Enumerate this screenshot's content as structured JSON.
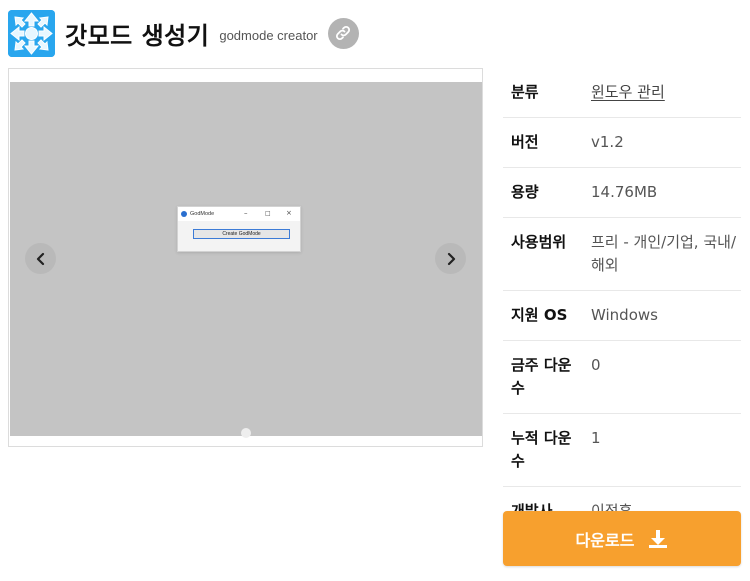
{
  "header": {
    "title": "갓모드 생성기",
    "subtitle": "godmode creator",
    "icon": "app-arrows-icon",
    "link_icon": "link-icon"
  },
  "carousel": {
    "prev_icon": "chevron-left-icon",
    "next_icon": "chevron-right-icon",
    "screenshot": {
      "window_title": "GodMode",
      "button_label": "Create GodMode"
    }
  },
  "info": {
    "rows": [
      {
        "label": "분류",
        "value": "윈도우 관리"
      },
      {
        "label": "버전",
        "value": "v1.2"
      },
      {
        "label": "용량",
        "value": "14.76MB"
      },
      {
        "label": "사용범위",
        "value": "프리 - 개인/기업, 국내/해외"
      },
      {
        "label": "지원 OS",
        "value": "Windows"
      },
      {
        "label": "금주 다운수",
        "value": "0"
      },
      {
        "label": "누적 다운수",
        "value": "1"
      },
      {
        "label": "개발사",
        "value": "이정훈"
      }
    ]
  },
  "download": {
    "label": "다운로드",
    "icon": "download-icon"
  },
  "colors": {
    "accent": "#f7a02e",
    "icon_blue": "#2aa4ea",
    "slide_bg": "#c4c4c4"
  }
}
